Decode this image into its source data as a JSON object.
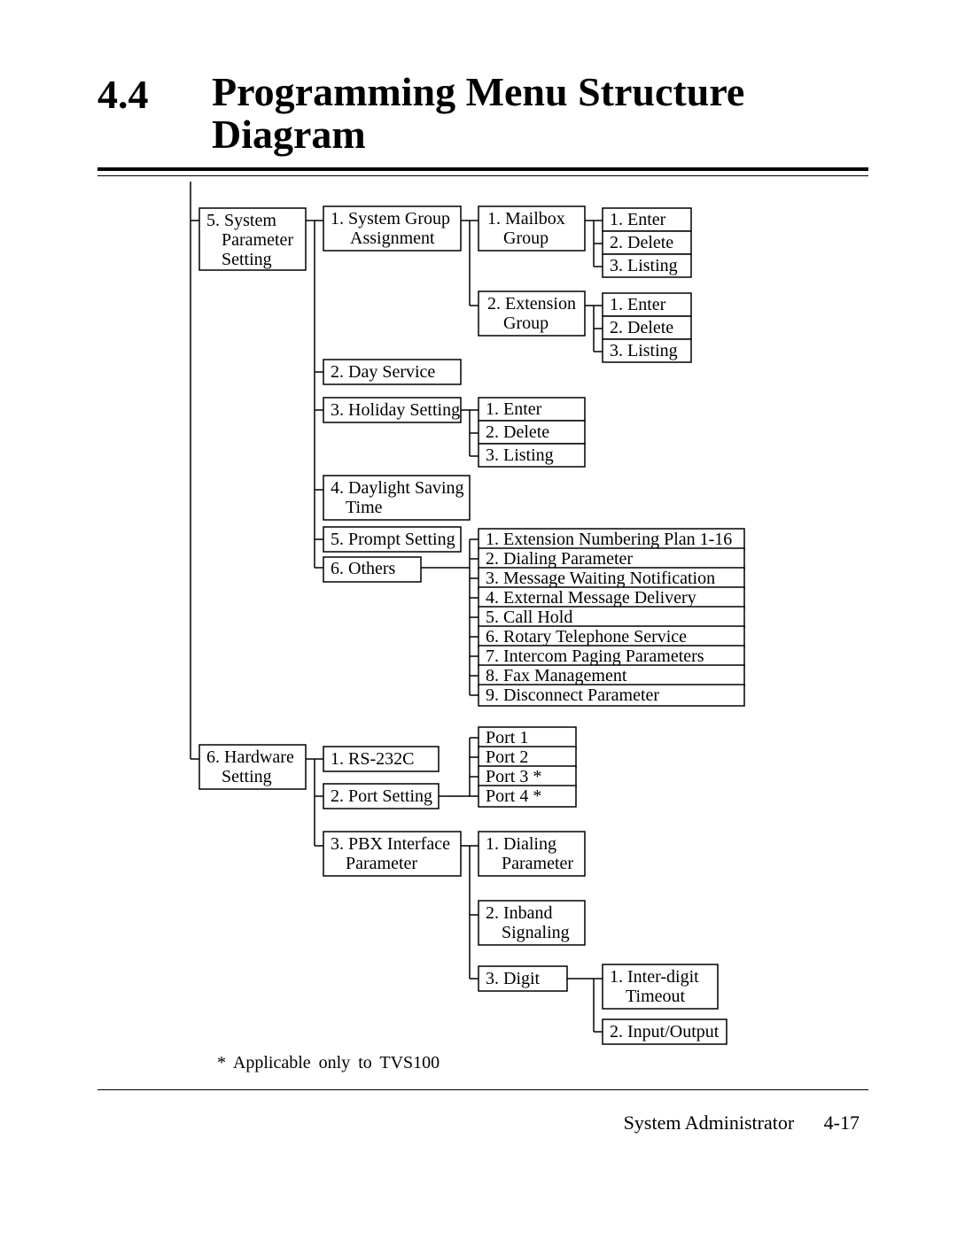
{
  "heading": {
    "number": "4.4",
    "title_line1": "Programming Menu Structure",
    "title_line2": "Diagram"
  },
  "footer": {
    "label": "System Administrator",
    "page": "4-17"
  },
  "footnote": "* Applicable only to TVS100",
  "chart_data": {
    "type": "tree",
    "title": "Programming Menu Structure Diagram (partial — items 5 and 6)",
    "nodes": [
      {
        "label": "5. System Parameter Setting",
        "children": [
          {
            "label": "1. System Group Assignment",
            "children": [
              {
                "label": "1. Mailbox Group",
                "children": [
                  {
                    "label": "1. Enter"
                  },
                  {
                    "label": "2. Delete"
                  },
                  {
                    "label": "3. Listing"
                  }
                ]
              },
              {
                "label": "2. Extension Group",
                "children": [
                  {
                    "label": "1. Enter"
                  },
                  {
                    "label": "2. Delete"
                  },
                  {
                    "label": "3. Listing"
                  }
                ]
              }
            ]
          },
          {
            "label": "2. Day Service"
          },
          {
            "label": "3. Holiday Setting",
            "children": [
              {
                "label": "1. Enter"
              },
              {
                "label": "2. Delete"
              },
              {
                "label": "3. Listing"
              }
            ]
          },
          {
            "label": "4. Daylight Saving Time"
          },
          {
            "label": "5. Prompt Setting"
          },
          {
            "label": "6. Others",
            "children": [
              {
                "label": "1. Extension Numbering Plan 1-16"
              },
              {
                "label": "2. Dialing Parameter"
              },
              {
                "label": "3. Message Waiting Notification"
              },
              {
                "label": "4. External Message Delivery"
              },
              {
                "label": "5. Call Hold"
              },
              {
                "label": "6. Rotary Telephone Service"
              },
              {
                "label": "7. Intercom Paging Parameters"
              },
              {
                "label": "8. Fax Management"
              },
              {
                "label": "9. Disconnect Parameter"
              }
            ]
          }
        ]
      },
      {
        "label": "6. Hardware Setting",
        "children": [
          {
            "label": "1. RS-232C"
          },
          {
            "label": "2. Port Setting",
            "children": [
              {
                "label": "Port 1"
              },
              {
                "label": "Port 2"
              },
              {
                "label": "Port 3 *"
              },
              {
                "label": "Port 4 *"
              }
            ]
          },
          {
            "label": "3. PBX Interface Parameter",
            "children": [
              {
                "label": "1. Dialing Parameter"
              },
              {
                "label": "2. Inband Signaling"
              },
              {
                "label": "3. Digit",
                "children": [
                  {
                    "label": "1. Inter-digit Timeout"
                  },
                  {
                    "label": "2. Input/Output"
                  }
                ]
              }
            ]
          }
        ]
      }
    ],
    "note": "* Applicable only to TVS100"
  },
  "labels": {
    "n5_l1": "5. System",
    "n5_l2": "Parameter",
    "n5_l3": "Setting",
    "c51_l1": "1. System Group",
    "c51_l2": "Assignment",
    "c52": "2. Day Service",
    "c53": "3. Holiday Setting",
    "c54_l1": "4. Daylight Saving",
    "c54_l2": "Time",
    "c55": "5. Prompt Setting",
    "c56": "6. Others",
    "g1_l1": "1. Mailbox",
    "g1_l2": "Group",
    "g2_l1": "2. Extension",
    "g2_l2": "Group",
    "edl_1": "1. Enter",
    "edl_2": "2. Delete",
    "edl_3": "3. Listing",
    "oth1": "1.  Extension Numbering Plan 1-16",
    "oth2": "2.  Dialing Parameter",
    "oth3": "3.  Message Waiting Notification",
    "oth4": "4.  External Message Delivery",
    "oth5": "5.  Call Hold",
    "oth6": "6.  Rotary Telephone Service",
    "oth7": "7.  Intercom Paging Parameters",
    "oth8": "8.  Fax Management",
    "oth9": "9.  Disconnect Parameter",
    "n6_l1": "6. Hardware",
    "n6_l2": "Setting",
    "hw1": "1. RS-232C",
    "hw2": "2. Port Setting",
    "hw3_l1": "3. PBX Interface",
    "hw3_l2": "Parameter",
    "port1": "Port 1",
    "port2": "Port 2",
    "port3": "Port 3  *",
    "port4": "Port 4  *",
    "pbx1_l1": "1. Dialing",
    "pbx1_l2": "Parameter",
    "pbx2_l1": "2. Inband",
    "pbx2_l2": "Signaling",
    "pbx3": "3. Digit",
    "dig1_l1": "1. Inter-digit",
    "dig1_l2": "Timeout",
    "dig2": "2. Input/Output"
  }
}
